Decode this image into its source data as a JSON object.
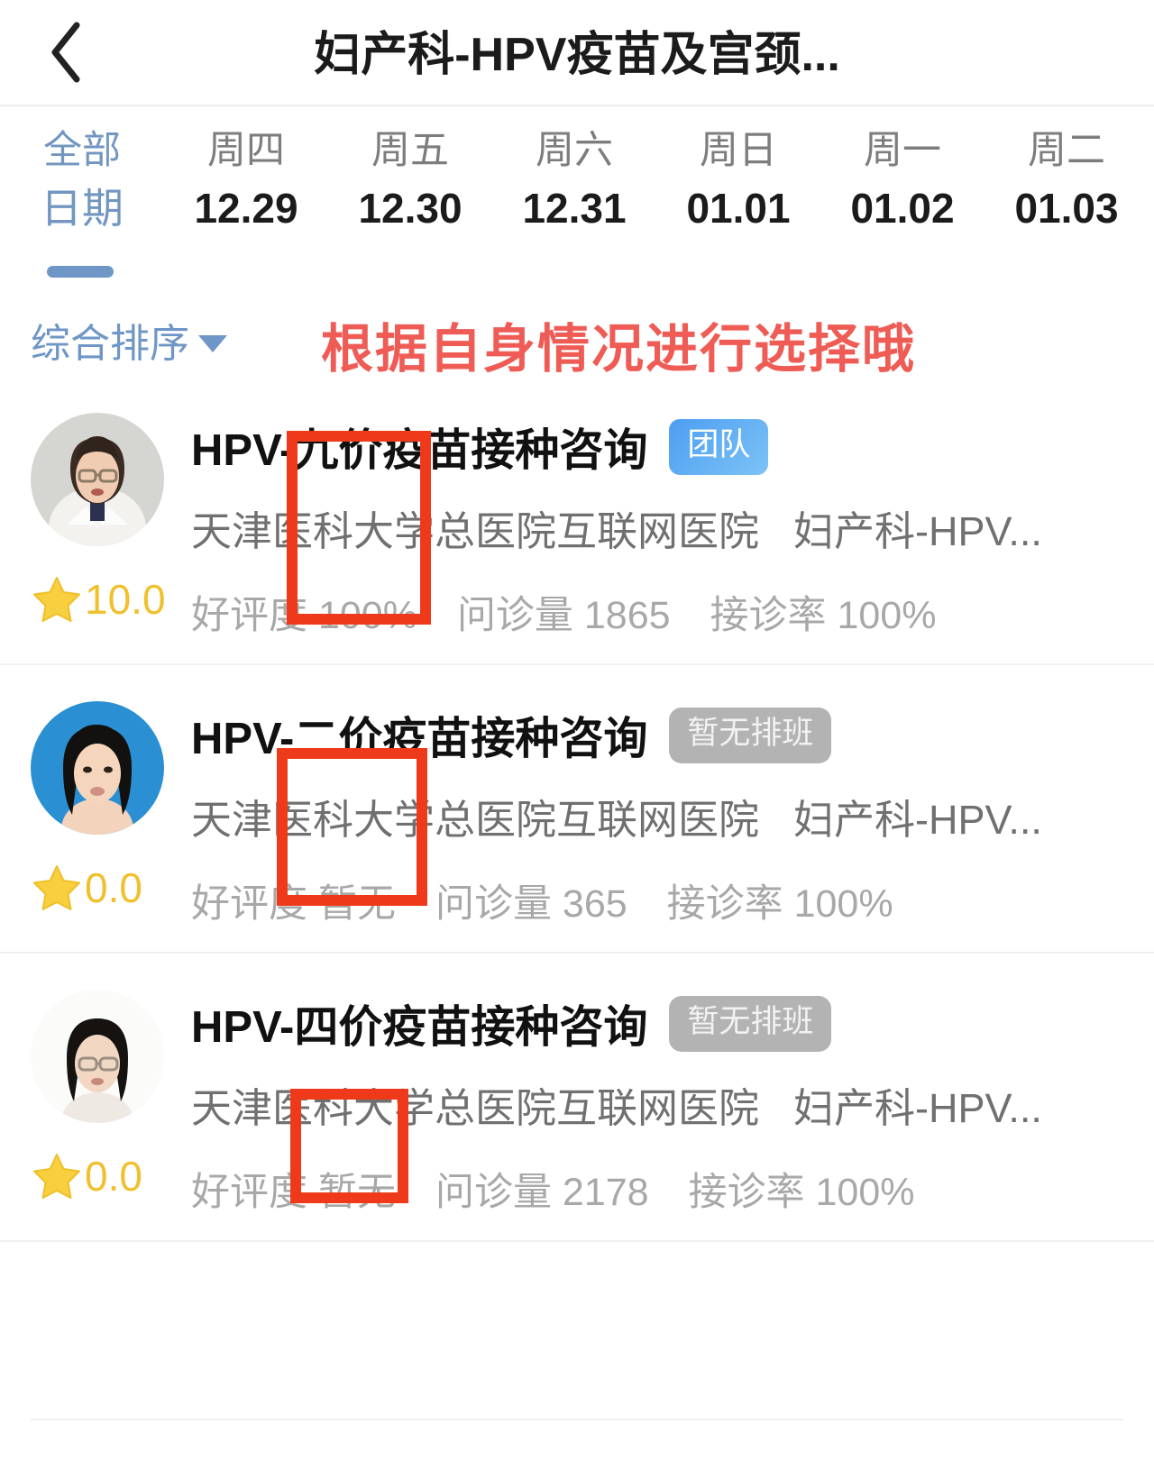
{
  "header": {
    "back_icon": "chevron-left-icon",
    "title": "妇产科-HPV疫苗及宫颈..."
  },
  "date_tabs": {
    "all": {
      "week": "全部",
      "date": "日期",
      "selected": true
    },
    "days": [
      {
        "week": "周四",
        "date": "12.29"
      },
      {
        "week": "周五",
        "date": "12.30"
      },
      {
        "week": "周六",
        "date": "12.31"
      },
      {
        "week": "周日",
        "date": "01.01"
      },
      {
        "week": "周一",
        "date": "01.02"
      },
      {
        "week": "周二",
        "date": "01.03"
      }
    ]
  },
  "sort": {
    "label": "综合排序",
    "caret_icon": "caret-down-icon"
  },
  "annotation": {
    "text": "根据自身情况进行选择哦",
    "color": "#ef5c55",
    "box_color": "#ee3a1a"
  },
  "doctors": [
    {
      "avatar": "doctor-avatar-glasses-white-coat",
      "title": "HPV-九价疫苗接种咨询",
      "badge": {
        "text": "团队",
        "type": "team"
      },
      "hospital": "天津医科大学总医院互联网医院",
      "department": "妇产科-HPV...",
      "rating": "10.0",
      "stats": [
        "好评度 100%",
        "问诊量 1865",
        "接诊率 100%"
      ]
    },
    {
      "avatar": "doctor-avatar-bob-hair-blue-bg",
      "title": "HPV-二价疫苗接种咨询",
      "badge": {
        "text": "暂无排班",
        "type": "unavailable"
      },
      "hospital": "天津医科大学总医院互联网医院",
      "department": "妇产科-HPV...",
      "rating": "0.0",
      "stats": [
        "好评度 暂无",
        "问诊量 365",
        "接诊率 100%"
      ]
    },
    {
      "avatar": "doctor-avatar-glasses-white-bg",
      "title": "HPV-四价疫苗接种咨询",
      "badge": {
        "text": "暂无排班",
        "type": "unavailable"
      },
      "hospital": "天津医科大学总医院互联网医院",
      "department": "妇产科-HPV...",
      "rating": "0.0",
      "stats": [
        "好评度 暂无",
        "问诊量 2178",
        "接诊率 100%"
      ]
    }
  ],
  "icons": {
    "star": "star-icon"
  }
}
